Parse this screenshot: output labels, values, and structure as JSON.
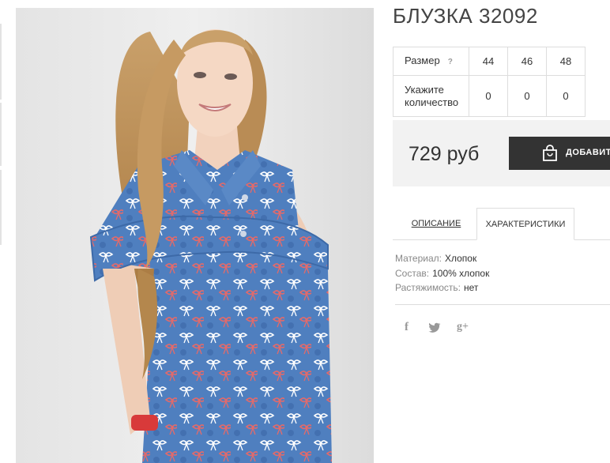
{
  "product": {
    "title": "БЛУЗКА 32092",
    "photo_alt": "blouse-photo"
  },
  "sizes_table": {
    "size_label": "Размер",
    "help_mark": "?",
    "qty_label_line1": "Укажите",
    "qty_label_line2": "количество",
    "sizes": [
      "44",
      "46",
      "48"
    ],
    "quantities": [
      "0",
      "0",
      "0"
    ]
  },
  "purchase": {
    "price": "729 руб",
    "add_button_label": "ДОБАВИТЬ"
  },
  "tabs": {
    "description": "ОПИСАНИЕ",
    "characteristics": "ХАРАКТЕРИСТИКИ",
    "active": "characteristics"
  },
  "characteristics": [
    {
      "key": "Материал:",
      "value": "Хлопок"
    },
    {
      "key": "Состав:",
      "value": "100% хлопок"
    },
    {
      "key": "Растяжимость:",
      "value": "нет"
    }
  ],
  "social": {
    "facebook": "f",
    "twitter": "twitter-icon",
    "googleplus": "g+"
  },
  "colors": {
    "button_bg": "#333333",
    "price_box_bg": "#f2f2f2",
    "border": "#dddddd",
    "shirt_blue": "#4a78b8"
  }
}
